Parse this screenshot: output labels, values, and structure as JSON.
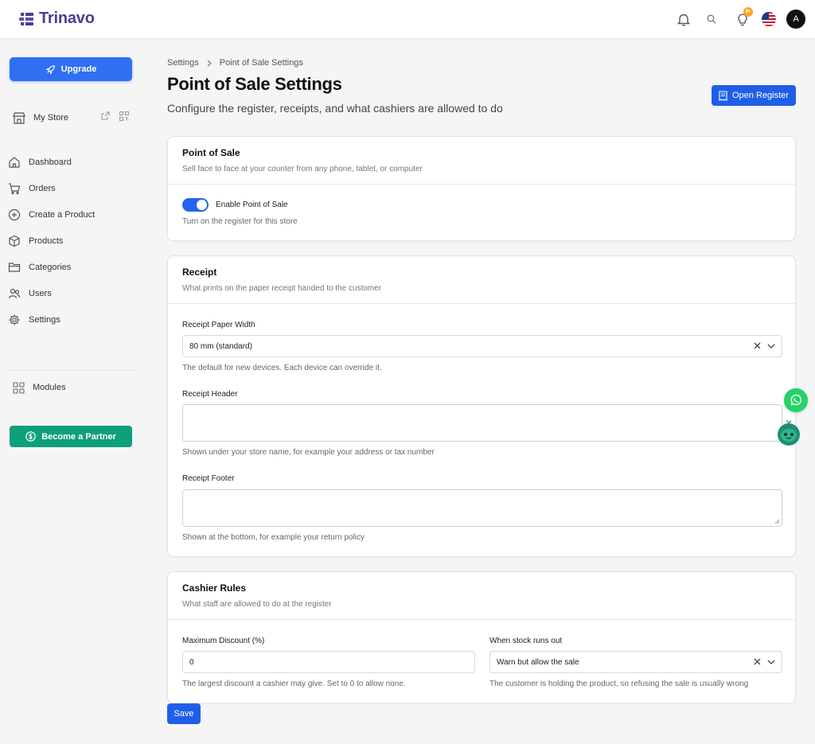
{
  "app": {
    "name": "Trinavo"
  },
  "header": {
    "icons": [
      "bell-icon",
      "search-icon",
      "lightbulb-icon",
      "us-flag-icon"
    ],
    "notification_badge": "9+",
    "avatar_initial": "A"
  },
  "sidebar": {
    "upgrade_label": "Upgrade",
    "store_label": "My Store",
    "items": [
      {
        "label": "Dashboard",
        "icon": "home-icon"
      },
      {
        "label": "Orders",
        "icon": "cart-icon"
      },
      {
        "label": "Create a Product",
        "icon": "plus-circle-icon"
      },
      {
        "label": "Products",
        "icon": "box-icon"
      },
      {
        "label": "Categories",
        "icon": "folder-icon"
      },
      {
        "label": "Users",
        "icon": "users-icon"
      },
      {
        "label": "Settings",
        "icon": "gear-icon"
      }
    ],
    "modules_label": "Modules",
    "partner_label": "Become a Partner"
  },
  "breadcrumb": {
    "items": [
      "Settings",
      "Point of Sale Settings"
    ]
  },
  "page": {
    "title": "Point of Sale Settings",
    "subtitle": "Configure the register, receipts, and what cashiers are allowed to do",
    "open_register_label": "Open Register"
  },
  "pos_card": {
    "title": "Point of Sale",
    "description": "Sell face to face at your counter from any phone, tablet, or computer",
    "toggle_label": "Enable Point of Sale",
    "toggle_help": "Turn on the register for this store",
    "toggle_on": true
  },
  "receipt_card": {
    "title": "Receipt",
    "description": "What prints on the paper receipt handed to the customer",
    "paper_width_label": "Receipt Paper Width",
    "paper_width_value": "80 mm (standard)",
    "paper_width_help": "The default for new devices. Each device can override it.",
    "header_label": "Receipt Header",
    "header_value": "",
    "header_help": "Shown under your store name, for example your address or tax number",
    "footer_label": "Receipt Footer",
    "footer_value": "",
    "footer_help": "Shown at the bottom, for example your return policy"
  },
  "cashier_card": {
    "title": "Cashier Rules",
    "description": "What staff are allowed to do at the register",
    "max_discount_label": "Maximum Discount (%)",
    "max_discount_value": "0",
    "max_discount_help": "The largest discount a cashier may give. Set to 0 to allow none.",
    "stock_label": "When stock runs out",
    "stock_value": "Warn but allow the sale",
    "stock_help": "The customer is holding the product, so refusing the sale is usually wrong"
  },
  "save_label": "Save",
  "colors": {
    "primary": "#1f5fe8",
    "partner": "#0e9f7b",
    "brand": "#4a3d8f",
    "whatsapp": "#25d366"
  }
}
